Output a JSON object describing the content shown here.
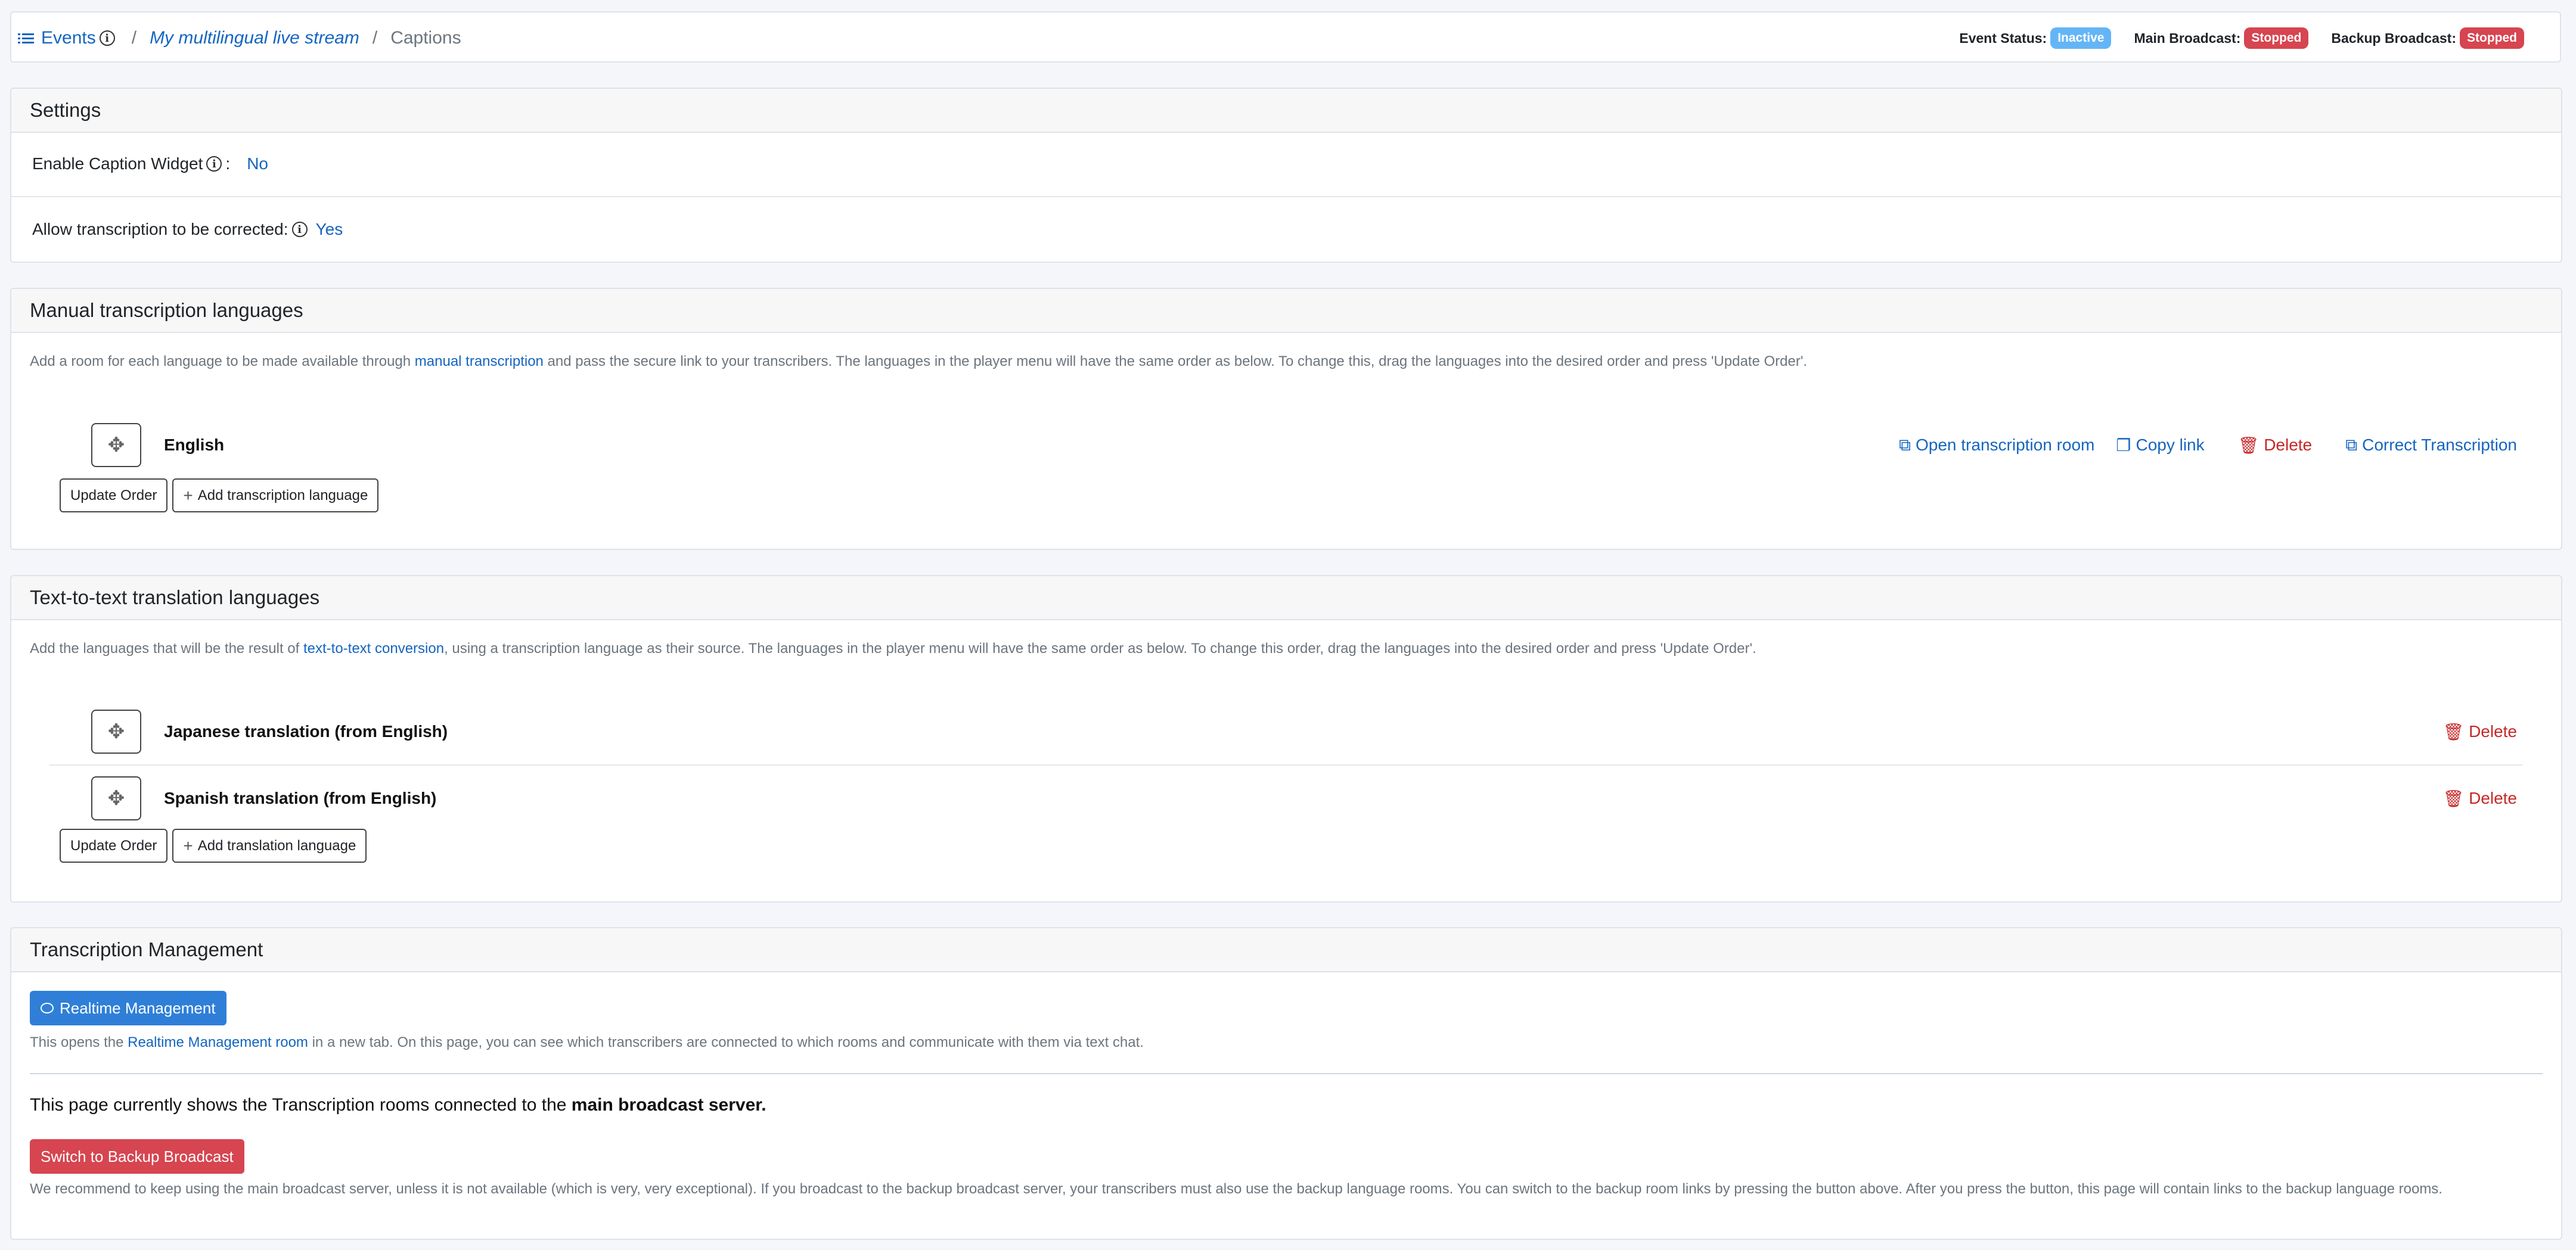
{
  "breadcrumb": {
    "events": "Events",
    "stream": "My multilingual live stream",
    "current": "Captions",
    "separator": "/"
  },
  "status": {
    "event_label": "Event Status:",
    "event_value": "Inactive",
    "main_label": "Main Broadcast:",
    "main_value": "Stopped",
    "backup_label": "Backup Broadcast:",
    "backup_value": "Stopped"
  },
  "settings": {
    "title": "Settings",
    "caption_widget_label": "Enable Caption Widget",
    "caption_widget_value": "No",
    "correction_label": "Allow transcription to be corrected:",
    "correction_value": "Yes"
  },
  "manual": {
    "title": "Manual transcription languages",
    "desc_before": "Add a room for each language to be made available through ",
    "desc_link": "manual transcription",
    "desc_after": " and pass the secure link to your transcribers. The languages in the player menu will have the same order as below. To change this, drag the languages into the desired order and press 'Update Order'.",
    "languages": [
      {
        "name": "English",
        "open_room": "Open transcription room",
        "copy_link": "Copy link",
        "delete": "Delete",
        "correct": "Correct Transcription"
      }
    ],
    "update_order": "Update Order",
    "add_language": "Add transcription language"
  },
  "translation": {
    "title": "Text-to-text translation languages",
    "desc_before": "Add the languages that will be the result of ",
    "desc_link": "text-to-text conversion",
    "desc_after": ", using a transcription language as their source. The languages in the player menu will have the same order as below. To change this order, drag the languages into the desired order and press 'Update Order'.",
    "languages": [
      {
        "name": "Japanese translation (from English)",
        "delete": "Delete"
      },
      {
        "name": "Spanish translation (from English)",
        "delete": "Delete"
      }
    ],
    "update_order": "Update Order",
    "add_language": "Add translation language"
  },
  "management": {
    "title": "Transcription Management",
    "realtime_button": "Realtime Management",
    "realtime_desc_before": "This opens the ",
    "realtime_desc_link": "Realtime Management room",
    "realtime_desc_after": " in a new tab. On this page, you can see which transcribers are connected to which rooms and communicate with them via text chat.",
    "server_text_before": "This page currently shows the Transcription rooms connected to the ",
    "server_text_bold": "main broadcast server.",
    "switch_button": "Switch to Backup Broadcast",
    "switch_desc": "We recommend to keep using the main broadcast server, unless it is not available (which is very, very exceptional). If you broadcast to the backup broadcast server, your transcribers must also use the backup language rooms. You can switch to the backup room links by pressing the button above. After you press the button, this page will contain links to the backup language rooms."
  }
}
